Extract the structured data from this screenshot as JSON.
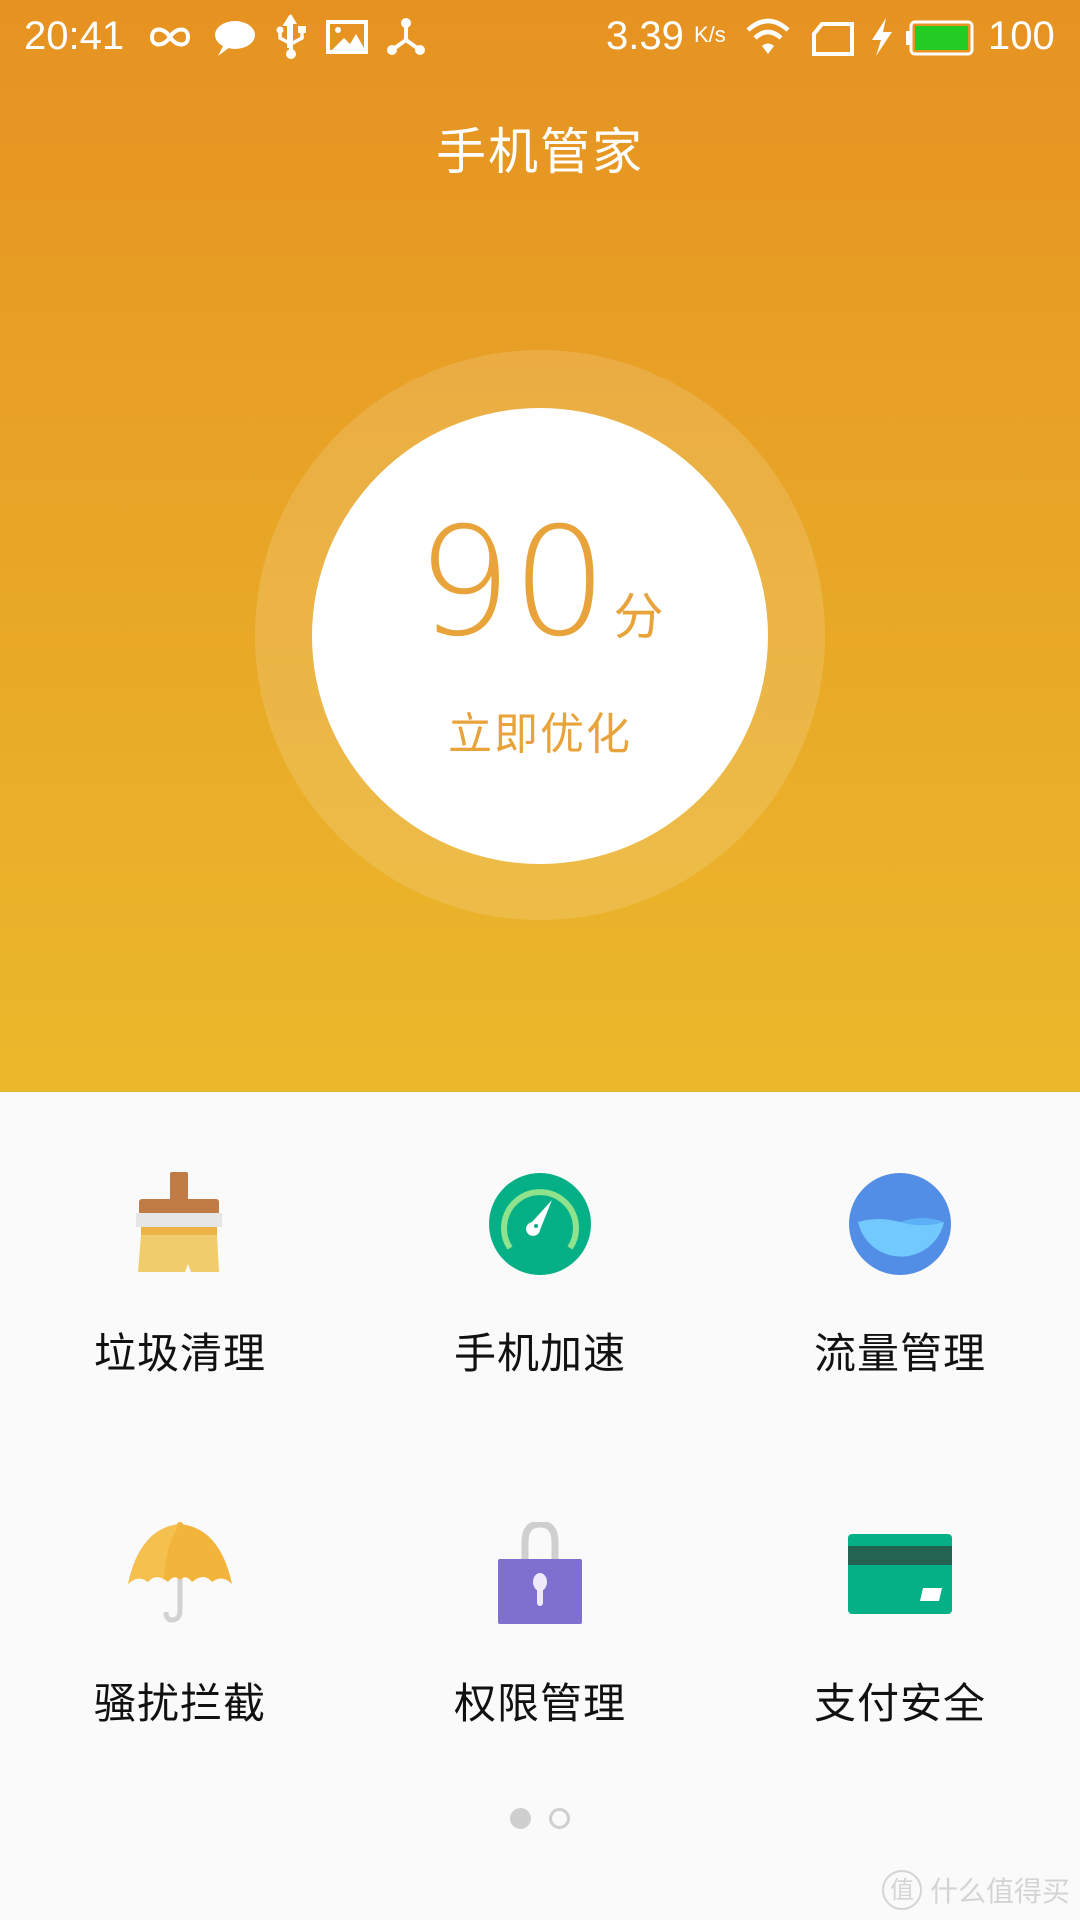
{
  "status_bar": {
    "time": "20:41",
    "notification_icons": [
      "infinity-icon",
      "message-bubble-icon",
      "usb-icon",
      "image-icon",
      "share-hub-icon"
    ],
    "network_speed": "3.39",
    "network_speed_unit": "K/s",
    "wifi": "wifi-icon",
    "sim": "sim-card-icon",
    "charging": "bolt-icon",
    "battery_level_percent": 100,
    "battery_text": "100",
    "battery_color": "#22cc22"
  },
  "header": {
    "title": "手机管家"
  },
  "score": {
    "value": "90",
    "unit": "分",
    "action_label": "立即优化",
    "accent_color": "#e8a33a"
  },
  "tools": [
    {
      "label": "垃圾清理",
      "icon": "broom-icon"
    },
    {
      "label": "手机加速",
      "icon": "speedometer-icon"
    },
    {
      "label": "流量管理",
      "icon": "water-level-icon"
    },
    {
      "label": "骚扰拦截",
      "icon": "umbrella-icon"
    },
    {
      "label": "权限管理",
      "icon": "padlock-icon"
    },
    {
      "label": "支付安全",
      "icon": "credit-card-icon"
    }
  ],
  "pager": {
    "page_count": 2,
    "current_page": 1
  },
  "watermark": {
    "badge": "值",
    "text": "什么值得买"
  },
  "theme": {
    "gradient_top": "#e69222",
    "gradient_bottom": "#ebb82b",
    "background": "#fafafa"
  }
}
